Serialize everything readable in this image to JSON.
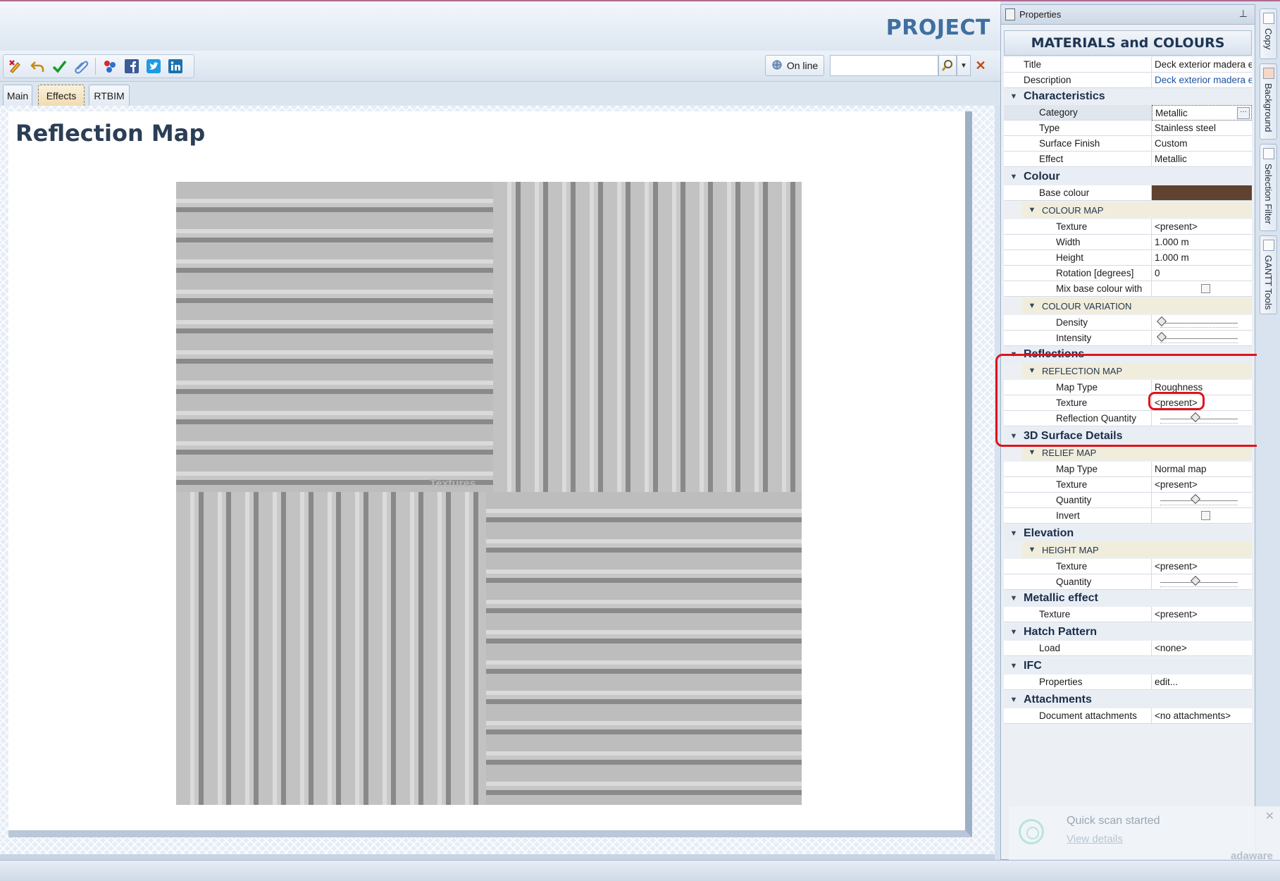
{
  "header": {
    "project_title": "PROJECT"
  },
  "toolbar": {
    "icons": [
      "pencil-check-icon",
      "undo-icon",
      "checkmark-icon",
      "paperclip-icon",
      "network-icon",
      "facebook-icon",
      "twitter-icon",
      "linkedin-icon"
    ],
    "online_label": "On line",
    "search_value": ""
  },
  "tabs": [
    {
      "label": "Main",
      "active": false
    },
    {
      "label": "Effects",
      "active": true
    },
    {
      "label": "RTBIM",
      "active": false
    }
  ],
  "content": {
    "title": "Reflection Map",
    "watermark": "Textures"
  },
  "properties": {
    "header": "Properties",
    "title": "MATERIALS and COLOURS",
    "title_row": {
      "label": "Title",
      "value": "Deck exterior madera en"
    },
    "description_row": {
      "label": "Description",
      "value": "Deck exterior madera en"
    },
    "characteristics": {
      "label": "Characteristics",
      "category": {
        "label": "Category",
        "value": "Metallic"
      },
      "type": {
        "label": "Type",
        "value": "Stainless steel"
      },
      "surface_finish": {
        "label": "Surface Finish",
        "value": "Custom"
      },
      "effect": {
        "label": "Effect",
        "value": "Metallic"
      }
    },
    "colour": {
      "label": "Colour",
      "base_colour": {
        "label": "Base colour",
        "value_hex": "#5f4230"
      },
      "colour_map": {
        "label": "COLOUR MAP",
        "texture": {
          "label": "Texture",
          "value": "<present>"
        },
        "width": {
          "label": "Width",
          "value": "1.000 m"
        },
        "height": {
          "label": "Height",
          "value": "1.000 m"
        },
        "rotation": {
          "label": "Rotation  [degrees]",
          "value": "0"
        },
        "mix": {
          "label": "Mix base colour with",
          "checked": false
        }
      },
      "colour_variation": {
        "label": "COLOUR VARIATION",
        "density": {
          "label": "Density",
          "level": 0.02
        },
        "intensity": {
          "label": "Intensity",
          "level": 0.02
        }
      }
    },
    "reflections": {
      "label": "Reflections",
      "reflection_map": {
        "label": "REFLECTION MAP",
        "map_type": {
          "label": "Map Type",
          "value": "Roughness"
        },
        "texture": {
          "label": "Texture",
          "value": "<present>"
        },
        "quantity": {
          "label": "Reflection Quantity",
          "level": 0.5
        }
      }
    },
    "surface": {
      "label": "3D Surface Details",
      "relief_map": {
        "label": "RELIEF MAP",
        "map_type": {
          "label": "Map Type",
          "value": "Normal map"
        },
        "texture": {
          "label": "Texture",
          "value": "<present>"
        },
        "quantity": {
          "label": "Quantity",
          "level": 0.5
        },
        "invert": {
          "label": "Invert",
          "checked": false
        }
      }
    },
    "elevation": {
      "label": "Elevation",
      "height_map": {
        "label": "HEIGHT MAP",
        "texture": {
          "label": "Texture",
          "value": "<present>"
        },
        "quantity": {
          "label": "Quantity",
          "level": 0.5
        }
      }
    },
    "metallic": {
      "label": "Metallic effect",
      "texture": {
        "label": "Texture",
        "value": "<present>"
      }
    },
    "hatch": {
      "label": "Hatch Pattern",
      "load": {
        "label": "Load",
        "value": "<none>"
      }
    },
    "ifc": {
      "label": "IFC",
      "properties": {
        "label": "Properties",
        "value": "edit..."
      }
    },
    "attachments": {
      "label": "Attachments",
      "docs": {
        "label": "Document attachments",
        "value": "<no attachments>"
      }
    }
  },
  "side_tabs": [
    "Copy",
    "Background",
    "Selection Filter",
    "GANTT Tools"
  ],
  "toast": {
    "title": "Quick scan started",
    "link": "View details",
    "brand": "adaware"
  }
}
